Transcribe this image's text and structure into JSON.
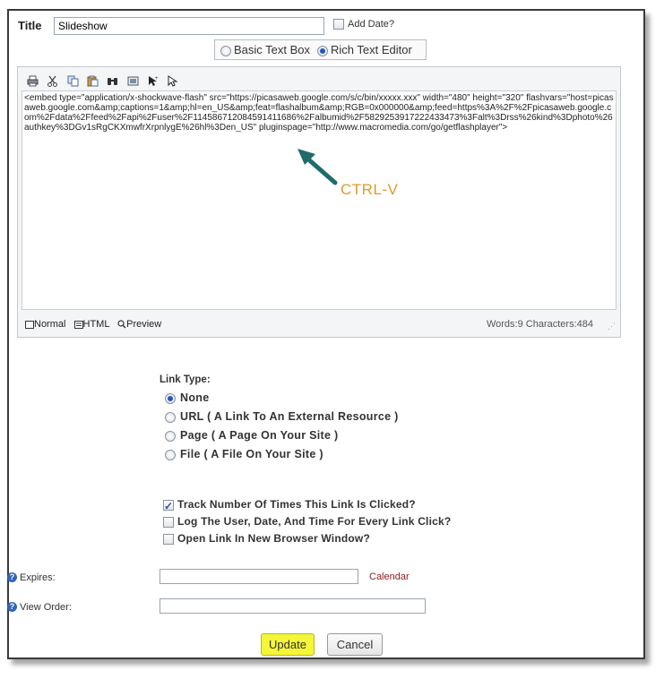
{
  "title": {
    "label": "Title",
    "value": "Slideshow",
    "add_date_label": "Add Date?",
    "add_date_checked": false
  },
  "editor_mode": {
    "options": [
      {
        "label": "Basic Text Box",
        "selected": false
      },
      {
        "label": "Rich Text Editor",
        "selected": true
      }
    ]
  },
  "toolbar": {
    "icons": [
      "print-icon",
      "cut-icon",
      "copy-icon",
      "paste-icon",
      "find-icon",
      "image-icon",
      "pointer-icon",
      "select-icon"
    ]
  },
  "editor": {
    "content": "<embed type=\"application/x-shockwave-flash\" src=\"https://picasaweb.google.com/s/c/bin/xxxxx.xxx\" width=\"480\" height=\"320\" flashvars=\"host=picasaweb.google.com&amp;captions=1&amp;hl=en_US&amp;feat=flashalbum&amp;RGB=0x000000&amp;feed=https%3A%2F%2Fpicasaweb.google.com%2Fdata%2Ffeed%2Fapi%2Fuser%2F114586712084591411686%2Falbumid%2F5829253917222433473%3Falt%3Drss%26kind%3Dphoto%26authkey%3DGv1sRgCKXmwfrXrpnlygE%26hl%3Den_US\" pluginspage=\"http://www.macromedia.com/go/getflashplayer\">",
    "footer": {
      "normal": "Normal",
      "html": "HTML",
      "preview": "Preview",
      "stats": "Words:9 Characters:484"
    }
  },
  "annotation": {
    "text": "CTRL-V",
    "color": "#e09a2a",
    "arrow_color": "#1f6b6b"
  },
  "link_type": {
    "heading": "Link Type:",
    "options": [
      {
        "label": "None",
        "selected": true
      },
      {
        "label": "URL ( A Link To An External Resource )",
        "selected": false
      },
      {
        "label": "Page ( A Page On Your Site )",
        "selected": false
      },
      {
        "label": "File ( A File On Your Site )",
        "selected": false
      }
    ]
  },
  "tracking": {
    "options": [
      {
        "label": "Track Number Of Times This Link Is Clicked?",
        "checked": true
      },
      {
        "label": "Log The User, Date, And Time For Every Link Click?",
        "checked": false
      },
      {
        "label": "Open Link In New Browser Window?",
        "checked": false
      }
    ]
  },
  "expires": {
    "label": "Expires:",
    "value": "",
    "calendar_label": "Calendar"
  },
  "view_order": {
    "label": "View Order:",
    "value": ""
  },
  "buttons": {
    "update": "Update",
    "cancel": "Cancel"
  },
  "colors": {
    "update_bg": "#f5f53a",
    "calendar_link": "#8b1a1a",
    "radio_selected": "#1f57c3"
  }
}
